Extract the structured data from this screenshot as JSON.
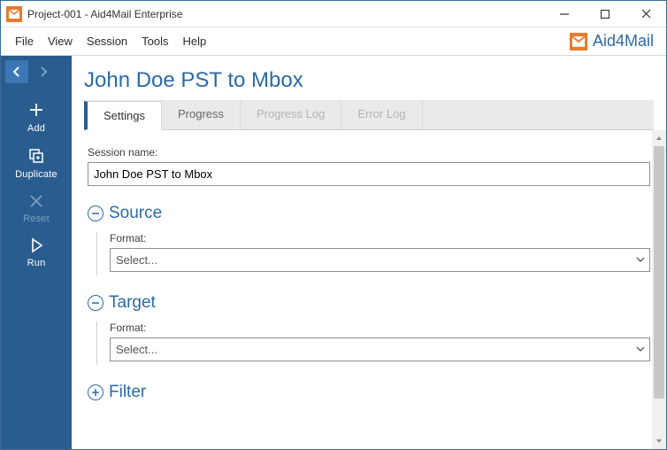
{
  "window": {
    "title": "Project-001 - Aid4Mail Enterprise"
  },
  "menu": {
    "items": [
      "File",
      "View",
      "Session",
      "Tools",
      "Help"
    ]
  },
  "brand": {
    "text": "Aid4Mail"
  },
  "sidebar": {
    "actions": {
      "add": "Add",
      "duplicate": "Duplicate",
      "reset": "Reset",
      "run": "Run"
    }
  },
  "page": {
    "title": "John Doe PST to Mbox",
    "tabs": {
      "settings": "Settings",
      "progress": "Progress",
      "progress_log": "Progress Log",
      "error_log": "Error Log"
    }
  },
  "session": {
    "name_label": "Session name:",
    "name_value": "John Doe PST to Mbox"
  },
  "source": {
    "heading": "Source",
    "format_label": "Format:",
    "format_value": "Select..."
  },
  "target": {
    "heading": "Target",
    "format_label": "Format:",
    "format_value": "Select..."
  },
  "filter": {
    "heading": "Filter"
  }
}
